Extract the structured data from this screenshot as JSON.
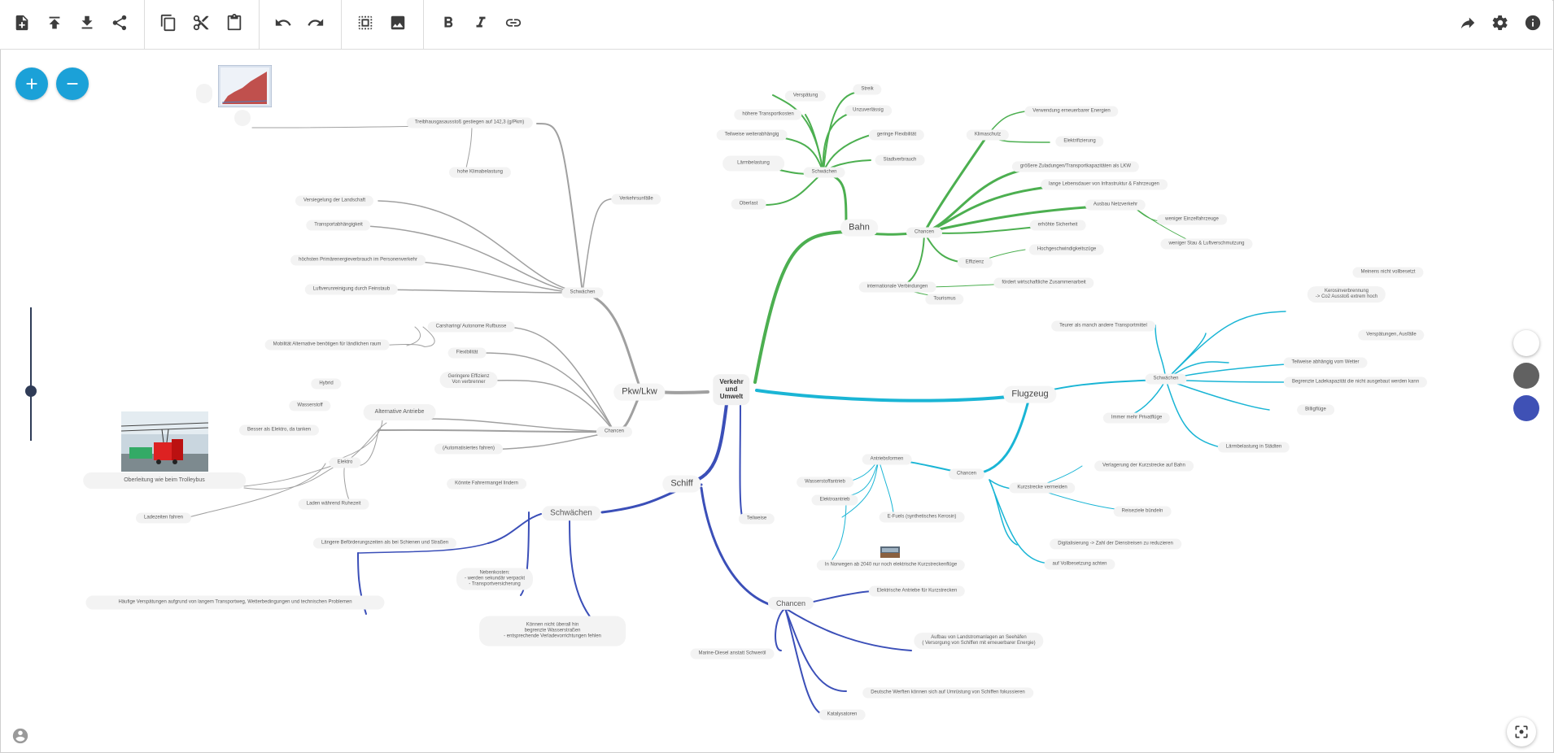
{
  "toolbar": {
    "buttons": [
      {
        "name": "new-file-icon"
      },
      {
        "name": "upload-icon"
      },
      {
        "name": "download-icon"
      },
      {
        "name": "share-icon"
      },
      {
        "name": "copy-icon"
      },
      {
        "name": "cut-icon"
      },
      {
        "name": "paste-icon"
      },
      {
        "name": "undo-icon"
      },
      {
        "name": "redo-icon"
      },
      {
        "name": "select-area-icon"
      },
      {
        "name": "image-icon"
      },
      {
        "name": "bold-icon"
      },
      {
        "name": "italic-icon"
      },
      {
        "name": "link-icon"
      },
      {
        "name": "share-arrow-icon"
      },
      {
        "name": "settings-icon"
      },
      {
        "name": "info-icon"
      }
    ]
  },
  "colors": {
    "accent": "#1ba1d8",
    "gray_branch": "#a0a0a0",
    "green_branch": "#4caf50",
    "cyan_branch": "#1ab5d5",
    "blue_branch": "#3b4fb8",
    "swatch_white": "#ffffff",
    "swatch_gray": "#616161",
    "swatch_blue": "#3f51b5"
  },
  "mindmap": {
    "root": "Verkehr\nund\nUmwelt",
    "pkw": {
      "title": "Pkw/Lkw",
      "schwaechen": "Schwächen",
      "chancen": "Chancen",
      "verkehrsunfaelle": "Verkehrsunfälle",
      "treibhaus": "Treibhausgasausstoß gestiegen auf 142,3 (g/Pkm)",
      "klima": "hohe Klimabelastung",
      "versiegelung": "Versiegelung der Landschaft",
      "transport": "Transportabhängigkeit",
      "primaer": "höchsten Primärenergieverbrauch im Personenverkehr",
      "luft": "Luftverunreinigung durch Feinstaub",
      "carsharing": "Carsharing/ Autonome Rufbusse",
      "mobilitaet": "Mobilität Alternative benötigen für ländlichen raum",
      "flexibilitaet": "Flexibilität",
      "geringere": "Geringere Effizienz\nVon verbrenner",
      "alternative": "Alternative Antriebe",
      "hybrid": "Hybrid",
      "wasserstoff": "Wasserstoff",
      "besser": "Besser als Elektro, da tanken",
      "elektro": "Elektro",
      "laden": "Laden während Ruhezeit",
      "oberleitung": "Oberleitung wie beim Trolleybus",
      "ladezeiten": "Ladezeiten fahren",
      "autonom": "(Automatisiertes fahren)",
      "fahrermangel": "Könnte Fahrermangel lindern"
    },
    "bahn": {
      "title": "Bahn",
      "schwaechen": "Schwächen",
      "chancen": "Chancen",
      "verspaetung": "Verspätung",
      "streik": "Streik",
      "unzuverlaessig": "Unzuverlässig",
      "hoehere": "höhere Transportkosten",
      "teilweise": "Teilweise weiterabhängig",
      "flexibel": "geringe Flexibilität",
      "staedte": "Stadtverbrauch",
      "laerm": "Lärmbelastung",
      "oberlast": "Oberlast",
      "klimaschutz": "Klimaschutz",
      "erneuerbar": "Verwendung erneuerbarer Energien",
      "elektrifizierung": "Elektrifizierung",
      "groesser": "größere Zuladungen/Transportkapazitäten als LKW",
      "lebensdauer": "lange Lebensdauer von Infrastruktur & Fahrzeugen",
      "ausbau": "Ausbau Netzverkehr",
      "einzel": "weniger Einzelfahrzeuge",
      "sicherheit": "erhöhte Sicherheit",
      "stau": "weniger Stau & Luftverschmutzung",
      "effizienz": "Effizienz",
      "hochgeschwindigkeit": "Hochgeschwindigkeitszüge",
      "international": "internationale Verbindungen",
      "tourismus": "Tourismus",
      "wirtschaft": "fördert wirtschaftliche Zusammenarbeit"
    },
    "flugzeug": {
      "title": "Flugzeug",
      "schwaechen": "Schwächen",
      "chancen": "Chancen",
      "meinens": "Meinens nicht vollbesetzt",
      "kerosin": "Kerosinverbrennung\n-> Co2 Ausstoß extrem hoch",
      "teurer": "Teurer als manch andere Transportmittel",
      "verspaetungen": "Verspätungen, Ausfälle",
      "wetter": "Teilweise abhängig vom Wetter",
      "ladekapazitaet": "Begrenzte Ladekapazität die nicht ausgebaut werden kann",
      "billig": "Billigflüge",
      "privat": "Immer mehr Privatflüge",
      "laermstaedte": "Lärmbelastung in Städten",
      "verlagerung": "Verlagerung der Kurzstrecke auf Bahn",
      "kurzstrecke": "Kurzstrecke vermeiden",
      "reiseziele": "Reiseziele bündeln",
      "digital": "Digitalisierung -> Zahl der Dienstreisen zu reduzieren",
      "vollbesetzung": "auf Vollbesetzung achten",
      "antriebsformen": "Antriebsformen",
      "wasserstoffantrieb": "Wasserstoffantrieb",
      "elektroantrieb": "Elektroantrieb",
      "efuels": "E-Fuels (synthetisches Kerosin)",
      "norwegen": "In Norwegen ab 2040 nur noch elektrische Kurzstreckenflüge"
    },
    "schiff": {
      "title": "Schiff",
      "schwaechen": "Schwächen",
      "chancen": "Chancen",
      "teilweise": "Teilweise",
      "laengere": "Längere Beförderungszeiten als bei Schienen und Straßen",
      "nebenkosten": "Nebenkosten:\n- werden sekundär verpackt\n- Transportversicherung",
      "verspaetungen": "Häufige Verspätungen aufgrund von langem Transportweg, Wetterbedingungen und technischen Problemen",
      "koennen": "Können nicht überall hin\nbegrenzte Wasserstraßen\n- entsprechende Verladevorrichtungen fehlen",
      "elektrisch": "Elektrische Antriebe für Kurzstrecken",
      "landstrom": "Aufbau von Landstromanlagen an Seehäfen\n( Versorgung von Schiffen mit erneuerbarer Energie)",
      "marine": "Marine-Diesel anstatt Schweröl",
      "werften": "Deutsche Werften können sich auf Umrüstung von Schiffen fokussieren",
      "katalysatoren": "Katalysatoren"
    }
  }
}
